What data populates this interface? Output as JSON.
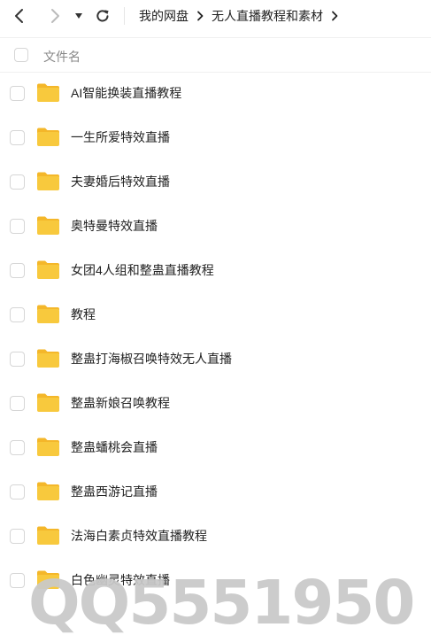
{
  "toolbar": {
    "back_icon": "chevron-left-icon",
    "forward_icon": "chevron-right-icon",
    "dropdown_icon": "caret-down-icon",
    "refresh_icon": "refresh-icon"
  },
  "breadcrumb": {
    "items": [
      "我的网盘",
      "无人直播教程和素材"
    ]
  },
  "header": {
    "column_label": "文件名"
  },
  "files": [
    {
      "name": "AI智能换装直播教程"
    },
    {
      "name": "一生所爱特效直播"
    },
    {
      "name": "夫妻婚后特效直播"
    },
    {
      "name": "奥特曼特效直播"
    },
    {
      "name": "女团4人组和整蛊直播教程"
    },
    {
      "name": "教程"
    },
    {
      "name": "整蛊打海椒召唤特效无人直播"
    },
    {
      "name": "整蛊新娘召唤教程"
    },
    {
      "name": "整蛊蟠桃会直播"
    },
    {
      "name": "整蛊西游记直播"
    },
    {
      "name": "法海白素贞特效直播教程"
    },
    {
      "name": "白色幽灵特效直播"
    }
  ],
  "watermark": "QQ5551950",
  "colors": {
    "folder": "#f8c93d",
    "folder_tab": "#f4b72a",
    "text": "#222222",
    "muted": "#888888",
    "icon": "#333333",
    "icon_disabled": "#bbbbbb",
    "watermark": "#c9c9c9"
  }
}
